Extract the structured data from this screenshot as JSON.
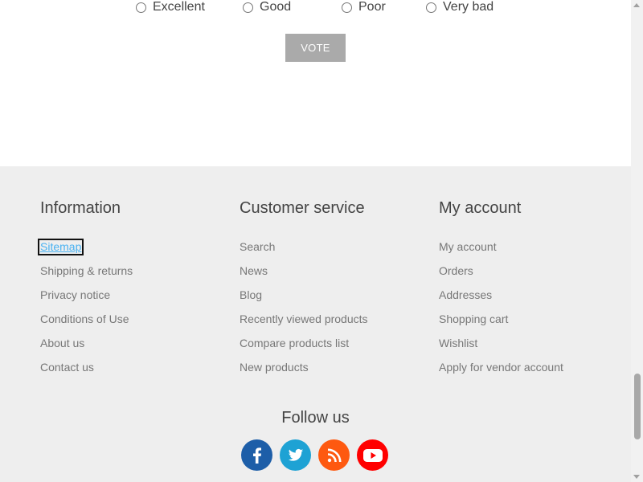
{
  "poll": {
    "answers": [
      "Excellent",
      "Good",
      "Poor",
      "Very bad"
    ],
    "vote_label": "VOTE"
  },
  "footer": {
    "columns": [
      {
        "title": "Information",
        "links": [
          "Sitemap",
          "Shipping & returns",
          "Privacy notice",
          "Conditions of Use",
          "About us",
          "Contact us"
        ]
      },
      {
        "title": "Customer service",
        "links": [
          "Search",
          "News",
          "Blog",
          "Recently viewed products",
          "Compare products list",
          "New products"
        ]
      },
      {
        "title": "My account",
        "links": [
          "My account",
          "Orders",
          "Addresses",
          "Shopping cart",
          "Wishlist",
          "Apply for vendor account"
        ]
      }
    ],
    "follow_us": "Follow us",
    "social": [
      {
        "icon": "facebook-icon",
        "color": "#1d5ea8"
      },
      {
        "icon": "twitter-icon",
        "color": "#1ea2d4"
      },
      {
        "icon": "rss-icon",
        "color": "#fe5910"
      },
      {
        "icon": "youtube-icon",
        "color": "#ff0000"
      }
    ]
  },
  "colors": {
    "footer_bg": "#eeeeee",
    "link": "#777777",
    "focused_link": "#4ab2f1",
    "vote_button": "#aaaaaa"
  }
}
